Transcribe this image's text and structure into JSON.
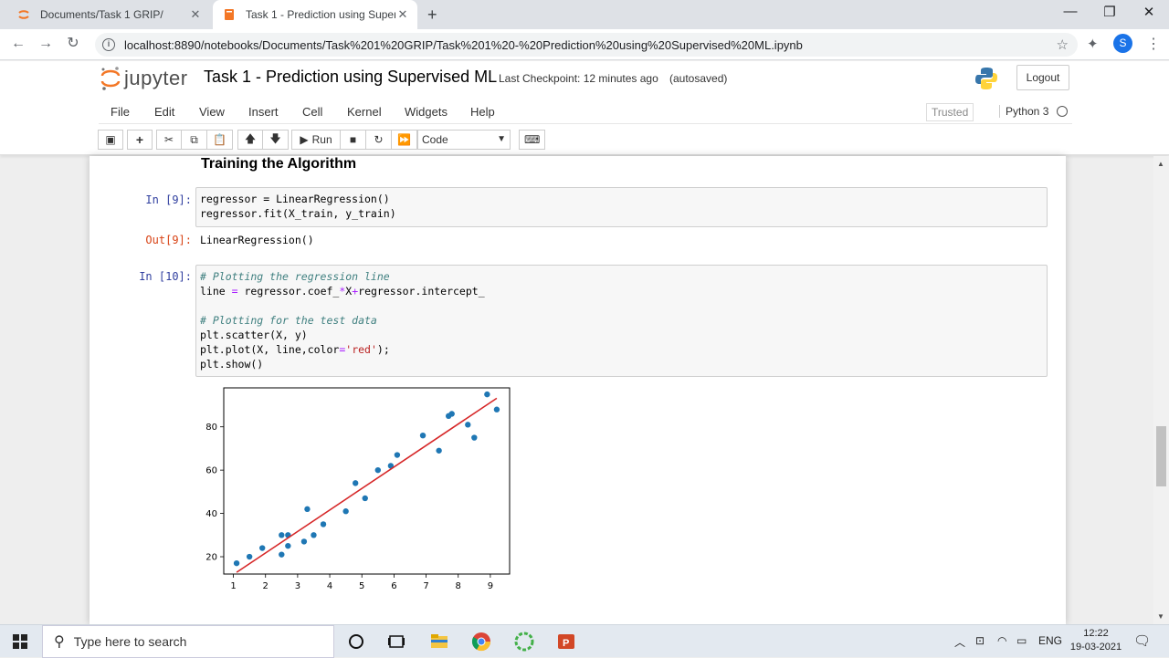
{
  "browser": {
    "tabs": [
      {
        "title": "Documents/Task 1 GRIP/",
        "active": false
      },
      {
        "title": "Task 1 - Prediction using Supervi",
        "active": true
      }
    ],
    "address": "localhost:8890/notebooks/Documents/Task%201%20GRIP/Task%201%20-%20Prediction%20using%20Supervised%20ML.ipynb",
    "profile_initial": "S"
  },
  "jupyter": {
    "logo_text": "jupyter",
    "notebook_title": "Task 1 - Prediction using Supervised ML",
    "checkpoint": "Last Checkpoint: 12 minutes ago",
    "autosave": "(autosaved)",
    "logout_label": "Logout",
    "menu": [
      "File",
      "Edit",
      "View",
      "Insert",
      "Cell",
      "Kernel",
      "Widgets",
      "Help"
    ],
    "trusted_label": "Trusted",
    "kernel_name": "Python 3",
    "run_label": "Run",
    "cell_type": "Code"
  },
  "notebook": {
    "heading": "Training the Algorithm",
    "cell9": {
      "prompt_in": "In [9]:",
      "lines": [
        "regressor = LinearRegression()",
        "regressor.fit(X_train, y_train)"
      ],
      "prompt_out": "Out[9]:",
      "output": "LinearRegression()"
    },
    "cell10": {
      "prompt_in": "In [10]:",
      "comment1": "# Plotting the regression line",
      "line2a": "line ",
      "line2op": "=",
      "line2b": " regressor.coef_",
      "line2op2": "*",
      "line2c": "X",
      "line2op3": "+",
      "line2d": "regressor.intercept_",
      "comment2": "# Plotting for the test data",
      "line5": "plt.scatter(X, y)",
      "line6a": "plt.plot(X, line,color",
      "line6op": "=",
      "line6str": "'red'",
      "line6b": ");",
      "line7": "plt.show()"
    }
  },
  "chart_data": {
    "type": "scatter",
    "title": "",
    "xlabel": "",
    "ylabel": "",
    "xlim": [
      0.7,
      9.6
    ],
    "ylim": [
      12,
      98
    ],
    "xticks": [
      "1",
      "2",
      "3",
      "4",
      "5",
      "6",
      "7",
      "8",
      "9"
    ],
    "yticks": [
      "20",
      "40",
      "60",
      "80"
    ],
    "x": [
      1.1,
      1.5,
      1.9,
      2.5,
      2.5,
      2.7,
      2.7,
      3.2,
      3.3,
      3.5,
      3.8,
      4.5,
      4.8,
      5.1,
      5.5,
      5.9,
      6.1,
      6.9,
      7.4,
      7.7,
      7.8,
      8.3,
      8.5,
      8.9,
      9.2
    ],
    "y": [
      17,
      20,
      24,
      21,
      30,
      25,
      30,
      27,
      42,
      30,
      35,
      41,
      54,
      47,
      60,
      62,
      67,
      76,
      69,
      85,
      86,
      81,
      75,
      95,
      88
    ],
    "line": {
      "color": "#d62728",
      "x": [
        1.1,
        9.2
      ],
      "y": [
        12.8,
        93.2
      ]
    },
    "point_color": "#1f77b4"
  },
  "taskbar": {
    "search_placeholder": "Type here to search",
    "language": "ENG",
    "time": "12:22",
    "date": "19-03-2021"
  }
}
